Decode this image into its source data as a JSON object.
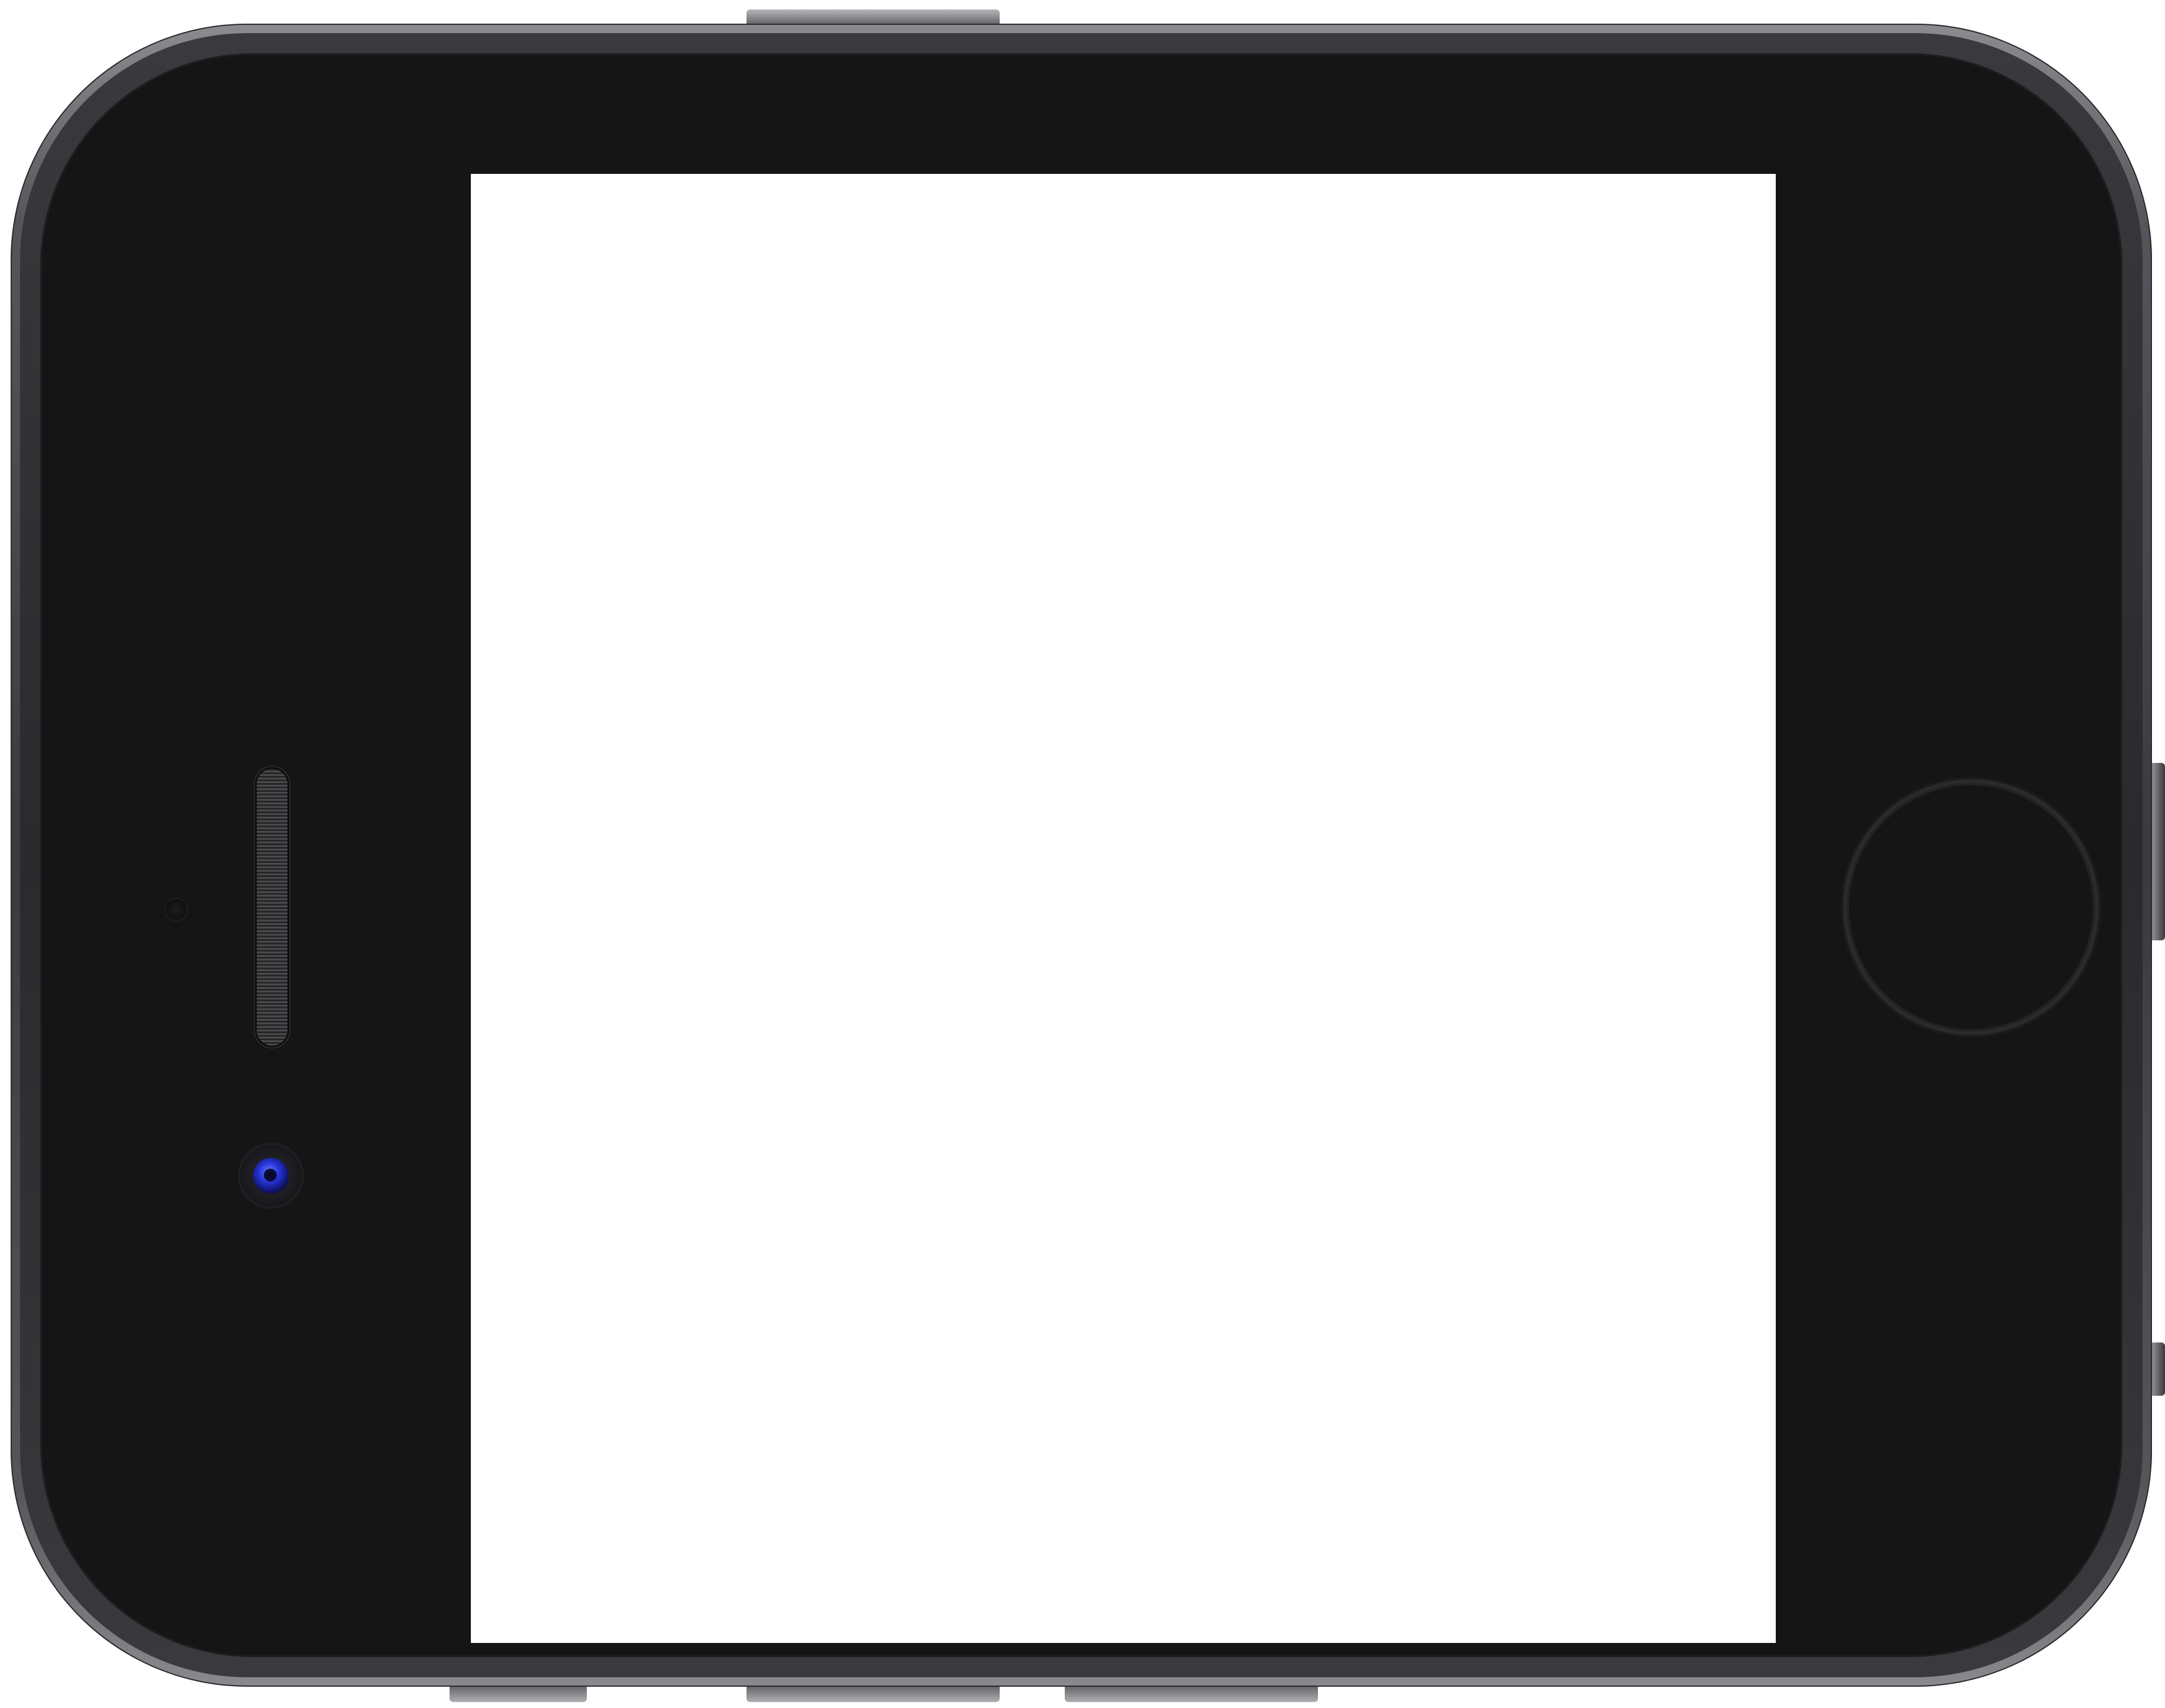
{
  "device": {
    "model": "",
    "orientation": "landscape",
    "body_color": "#3a3a3e",
    "face_color": "#151515",
    "screen_color": "#ffffff",
    "camera_lens_color": "#2634d8",
    "icons": {
      "speaker": "speaker-grille-icon",
      "camera": "front-camera-icon",
      "sensor": "proximity-sensor-icon",
      "home": "home-button-icon"
    }
  },
  "screen": {
    "content": ""
  }
}
